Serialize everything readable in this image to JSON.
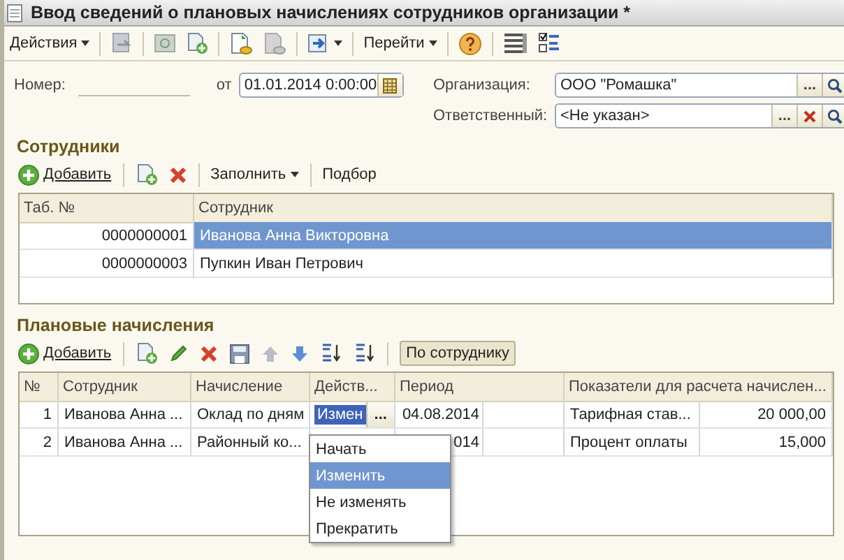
{
  "window": {
    "title": "Ввод сведений о плановых начислениях сотрудников организации *"
  },
  "toolbar": {
    "actions": "Действия",
    "goto": "Перейти"
  },
  "form": {
    "number_label": "Номер:",
    "date_label": "от",
    "date_value": "01.01.2014 0:00:00",
    "organization": {
      "label": "Организация:",
      "value": "ООО \"Ромашка\"",
      "select_button": "..."
    },
    "responsible": {
      "label": "Ответственный:",
      "value": "<Не указан>",
      "select_button": "..."
    }
  },
  "employees": {
    "title": "Сотрудники",
    "toolbar": {
      "add": "Добавить",
      "fill": "Заполнить",
      "pick": "Подбор"
    },
    "columns": [
      "Таб. №",
      "Сотрудник"
    ],
    "rows": [
      {
        "tab_no": "0000000001",
        "name": "Иванова Анна Викторовна",
        "selected": true
      },
      {
        "tab_no": "0000000003",
        "name": "Пупкин Иван Петрович",
        "selected": false
      }
    ]
  },
  "accruals": {
    "title": "Плановые начисления",
    "toolbar": {
      "add": "Добавить",
      "by_employee": {
        "label": "По сотруднику",
        "on": true
      }
    },
    "columns": [
      "№",
      "Сотрудник",
      "Начисление",
      "Действ...",
      "Период",
      "Показатели для расчета начислен..."
    ],
    "rows": [
      {
        "n": "1",
        "employee": "Иванова Анна ...",
        "accrual": "Оклад по дням",
        "editing": true,
        "action": "Измен",
        "choice_button": "...",
        "period": "04.08.2014",
        "indicator": "Тарифная став...",
        "value": "20 000,00"
      },
      {
        "n": "2",
        "employee": "Иванова Анна ...",
        "accrual": "Районный ко...",
        "editing": false,
        "period": "014",
        "indicator": "Процент оплаты",
        "value": "15,000"
      }
    ],
    "action_menu": [
      {
        "label": "Начать",
        "selected": false
      },
      {
        "label": "Изменить",
        "selected": true
      },
      {
        "label": "Не изменять",
        "selected": false
      },
      {
        "label": "Прекратить",
        "selected": false
      }
    ]
  }
}
